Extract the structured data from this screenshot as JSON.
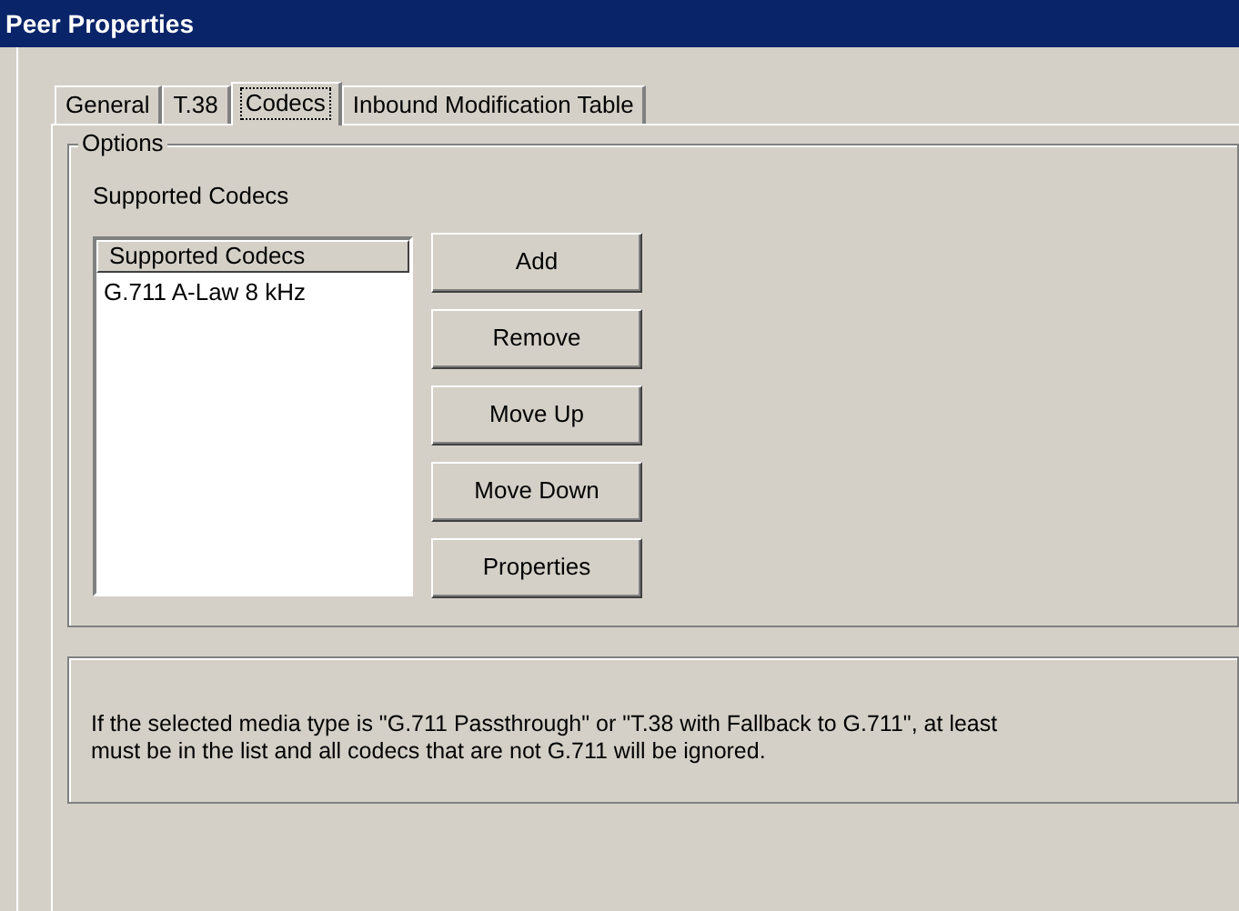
{
  "window": {
    "title": "Peer Properties"
  },
  "tabs": [
    {
      "label": "General",
      "selected": false
    },
    {
      "label": "T.38",
      "selected": false
    },
    {
      "label": "Codecs",
      "selected": true
    },
    {
      "label": "Inbound Modification Table",
      "selected": false
    }
  ],
  "options": {
    "title": "Options",
    "label": "Supported Codecs",
    "list": {
      "header": "Supported Codecs",
      "items": [
        "G.711 A-Law 8 kHz"
      ]
    },
    "buttons": [
      "Add",
      "Remove",
      "Move Up",
      "Move Down",
      "Properties"
    ]
  },
  "note": {
    "lines": [
      "If the selected media type is \"G.711 Passthrough\" or \"T.38 with Fallback to G.711\", at least",
      "must be in the list and all codecs that are not G.711 will be ignored."
    ]
  }
}
